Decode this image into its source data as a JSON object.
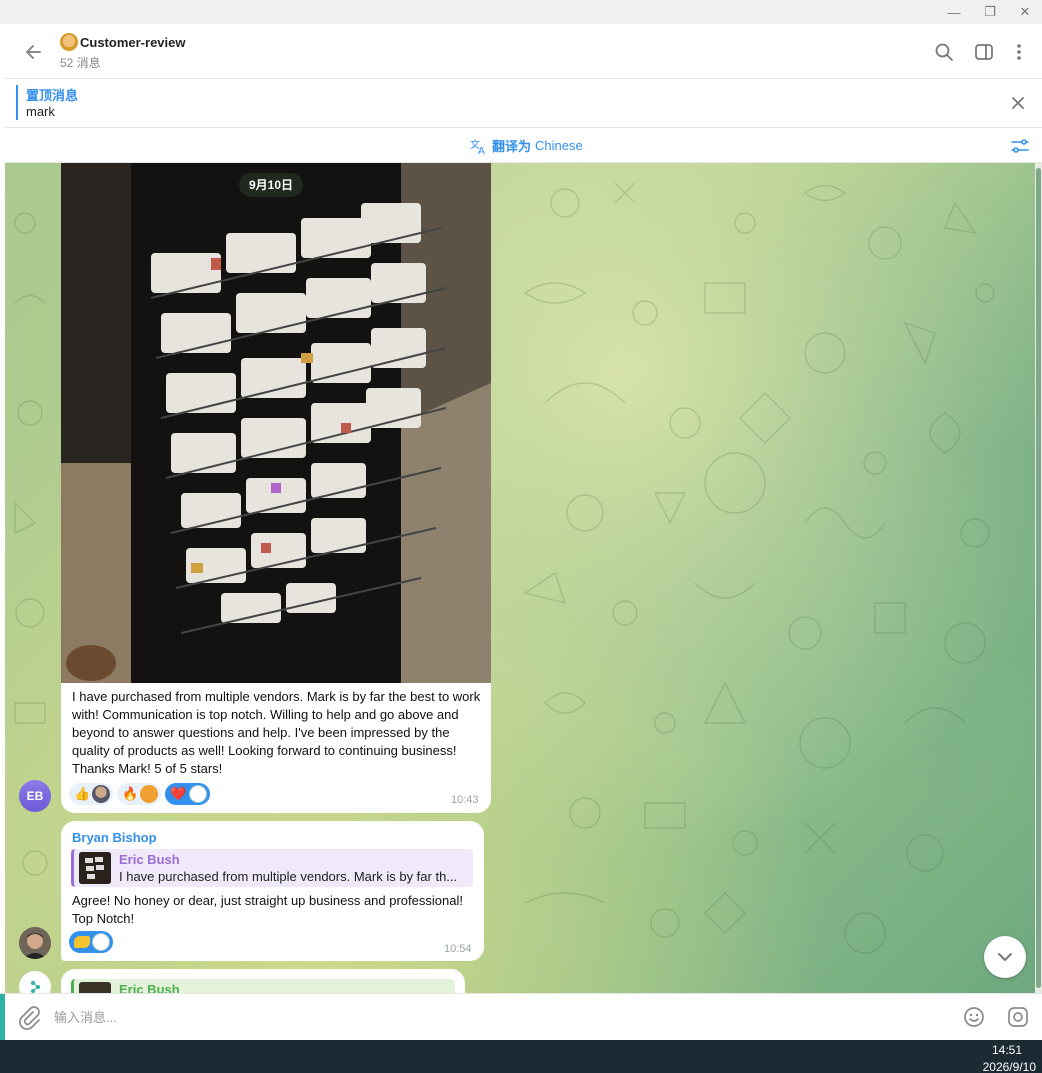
{
  "window": {
    "minimize_glyph": "—",
    "restore_glyph": "❐",
    "close_glyph": "✕"
  },
  "header": {
    "title": "Customer-review",
    "subtitle": "52 消息",
    "icons": [
      "back-arrow-icon",
      "search-icon",
      "side-panel-icon",
      "more-vertical-icon"
    ]
  },
  "pinned": {
    "title": "置顶消息",
    "text": "mark"
  },
  "translate": {
    "prefix": "翻译为",
    "language": "Chinese"
  },
  "chat": {
    "date": "9月10日",
    "messages": [
      {
        "avatar_initials": "EB",
        "text": "I have purchased from multiple vendors. Mark is by far the best to work with! Communication is top notch. Willing to help and go above and beyond to answer questions and help. I've been impressed by the quality of products as well! Looking forward to continuing business! Thanks Mark! 5 of 5 stars!",
        "time": "10:43",
        "reactions": [
          {
            "emoji": "👍"
          },
          {
            "emoji": "🔥"
          },
          {
            "emoji": "❤️"
          }
        ]
      },
      {
        "sender": "Bryan Bishop",
        "reply_to_name": "Eric Bush",
        "reply_to_text": "I have purchased from multiple vendors. Mark is by far th...",
        "text": "Agree! No honey or dear, just straight up business and professional! Top Notch!",
        "time": "10:54"
      },
      {
        "reply_to_name": "Eric Bush"
      }
    ]
  },
  "composer": {
    "placeholder": "输入消息..."
  },
  "taskbar": {
    "time": "14:51",
    "date": "2026/9/10"
  },
  "colors": {
    "accent": "#3390ec",
    "reply_purple": "#9b6dd6",
    "reply_green": "#4caf50",
    "avatar_eb": "#7b6be0"
  }
}
